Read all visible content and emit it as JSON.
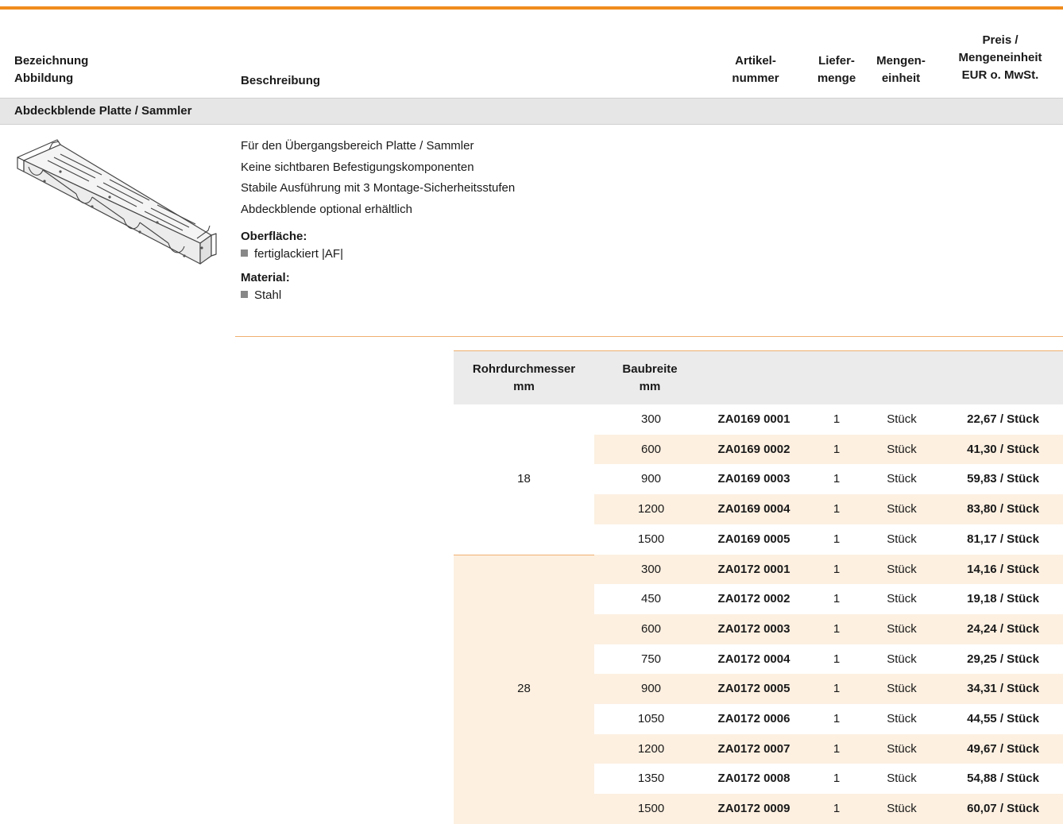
{
  "header": {
    "col_name": [
      "Bezeichnung",
      "Abbildung"
    ],
    "col_desc": "Beschreibung",
    "col_article": [
      "Artikel-",
      "nummer"
    ],
    "col_delivery": [
      "Liefer-",
      "menge"
    ],
    "col_unit": [
      "Mengen-",
      "einheit"
    ],
    "col_price": [
      "Preis /",
      "Mengeneinheit",
      "EUR o. MwSt."
    ]
  },
  "section": {
    "title": "Abdeckblende Platte / Sammler",
    "description": [
      "Für den Übergangsbereich Platte / Sammler",
      "Keine sichtbaren Befestigungskomponenten",
      "Stabile Ausführung mit 3 Montage-Sicherheitsstufen",
      "Abdeckblende optional erhältlich"
    ],
    "surface_label": "Oberfläche:",
    "surface_value": "fertiglackiert |AF|",
    "material_label": "Material:",
    "material_value": "Stahl",
    "image_icon": "corrugated-cover-plate-drawing"
  },
  "variants_header": {
    "diameter": [
      "Rohrdurchmesser",
      "mm"
    ],
    "width": [
      "Baubreite",
      "mm"
    ]
  },
  "groups": [
    {
      "diameter": "18",
      "rows": [
        {
          "width": "300",
          "article": "ZA0169 0001",
          "qty": "1",
          "unit": "Stück",
          "price": "22,67 / Stück"
        },
        {
          "width": "600",
          "article": "ZA0169 0002",
          "qty": "1",
          "unit": "Stück",
          "price": "41,30 / Stück"
        },
        {
          "width": "900",
          "article": "ZA0169 0003",
          "qty": "1",
          "unit": "Stück",
          "price": "59,83 / Stück"
        },
        {
          "width": "1200",
          "article": "ZA0169 0004",
          "qty": "1",
          "unit": "Stück",
          "price": "83,80 / Stück"
        },
        {
          "width": "1500",
          "article": "ZA0169 0005",
          "qty": "1",
          "unit": "Stück",
          "price": "81,17 / Stück"
        }
      ]
    },
    {
      "diameter": "28",
      "rows": [
        {
          "width": "300",
          "article": "ZA0172 0001",
          "qty": "1",
          "unit": "Stück",
          "price": "14,16 / Stück"
        },
        {
          "width": "450",
          "article": "ZA0172 0002",
          "qty": "1",
          "unit": "Stück",
          "price": "19,18 / Stück"
        },
        {
          "width": "600",
          "article": "ZA0172 0003",
          "qty": "1",
          "unit": "Stück",
          "price": "24,24 / Stück"
        },
        {
          "width": "750",
          "article": "ZA0172 0004",
          "qty": "1",
          "unit": "Stück",
          "price": "29,25 / Stück"
        },
        {
          "width": "900",
          "article": "ZA0172 0005",
          "qty": "1",
          "unit": "Stück",
          "price": "34,31 / Stück"
        },
        {
          "width": "1050",
          "article": "ZA0172 0006",
          "qty": "1",
          "unit": "Stück",
          "price": "44,55 / Stück"
        },
        {
          "width": "1200",
          "article": "ZA0172 0007",
          "qty": "1",
          "unit": "Stück",
          "price": "49,67 / Stück"
        },
        {
          "width": "1350",
          "article": "ZA0172 0008",
          "qty": "1",
          "unit": "Stück",
          "price": "54,88 / Stück"
        },
        {
          "width": "1500",
          "article": "ZA0172 0009",
          "qty": "1",
          "unit": "Stück",
          "price": "60,07 / Stück"
        }
      ]
    }
  ],
  "colors": {
    "accent": "#f08c1e",
    "row_alt": "#fdf0e1",
    "header_bg": "#ebebeb"
  }
}
